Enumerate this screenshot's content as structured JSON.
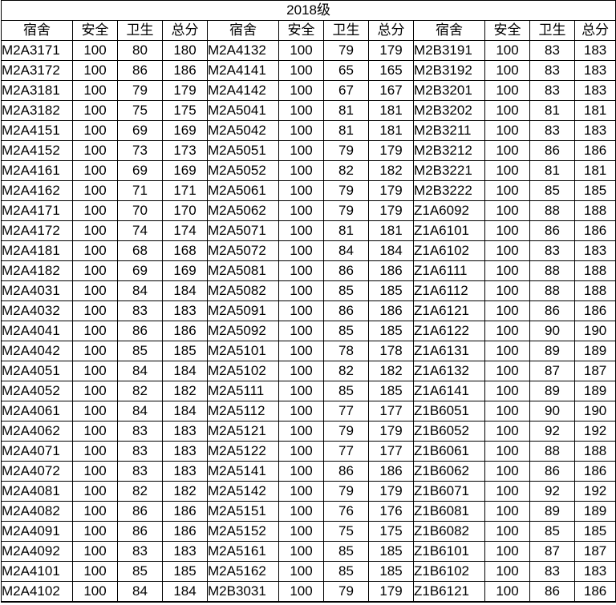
{
  "sheet": {
    "title": "2018级",
    "headers": [
      "宿舍",
      "安全",
      "卫生",
      "总分"
    ],
    "groups": [
      {
        "rows": [
          [
            "M2A3171",
            "100",
            "80",
            "180"
          ],
          [
            "M2A3172",
            "100",
            "86",
            "186"
          ],
          [
            "M2A3181",
            "100",
            "79",
            "179"
          ],
          [
            "M2A3182",
            "100",
            "75",
            "175"
          ],
          [
            "M2A4151",
            "100",
            "69",
            "169"
          ],
          [
            "M2A4152",
            "100",
            "73",
            "173"
          ],
          [
            "M2A4161",
            "100",
            "69",
            "169"
          ],
          [
            "M2A4162",
            "100",
            "71",
            "171"
          ],
          [
            "M2A4171",
            "100",
            "70",
            "170"
          ],
          [
            "M2A4172",
            "100",
            "74",
            "174"
          ],
          [
            "M2A4181",
            "100",
            "68",
            "168"
          ],
          [
            "M2A4182",
            "100",
            "69",
            "169"
          ],
          [
            "M2A4031",
            "100",
            "84",
            "184"
          ],
          [
            "M2A4032",
            "100",
            "83",
            "183"
          ],
          [
            "M2A4041",
            "100",
            "86",
            "186"
          ],
          [
            "M2A4042",
            "100",
            "85",
            "185"
          ],
          [
            "M2A4051",
            "100",
            "84",
            "184"
          ],
          [
            "M2A4052",
            "100",
            "82",
            "182"
          ],
          [
            "M2A4061",
            "100",
            "84",
            "184"
          ],
          [
            "M2A4062",
            "100",
            "83",
            "183"
          ],
          [
            "M2A4071",
            "100",
            "83",
            "183"
          ],
          [
            "M2A4072",
            "100",
            "83",
            "183"
          ],
          [
            "M2A4081",
            "100",
            "82",
            "182"
          ],
          [
            "M2A4082",
            "100",
            "86",
            "186"
          ],
          [
            "M2A4091",
            "100",
            "86",
            "186"
          ],
          [
            "M2A4092",
            "100",
            "83",
            "183"
          ],
          [
            "M2A4101",
            "100",
            "85",
            "185"
          ],
          [
            "M2A4102",
            "100",
            "84",
            "184"
          ]
        ]
      },
      {
        "rows": [
          [
            "M2A4132",
            "100",
            "79",
            "179"
          ],
          [
            "M2A4141",
            "100",
            "65",
            "165"
          ],
          [
            "M2A4142",
            "100",
            "67",
            "167"
          ],
          [
            "M2A5041",
            "100",
            "81",
            "181"
          ],
          [
            "M2A5042",
            "100",
            "81",
            "181"
          ],
          [
            "M2A5051",
            "100",
            "79",
            "179"
          ],
          [
            "M2A5052",
            "100",
            "82",
            "182"
          ],
          [
            "M2A5061",
            "100",
            "79",
            "179"
          ],
          [
            "M2A5062",
            "100",
            "79",
            "179"
          ],
          [
            "M2A5071",
            "100",
            "81",
            "181"
          ],
          [
            "M2A5072",
            "100",
            "84",
            "184"
          ],
          [
            "M2A5081",
            "100",
            "86",
            "186"
          ],
          [
            "M2A5082",
            "100",
            "85",
            "185"
          ],
          [
            "M2A5091",
            "100",
            "86",
            "186"
          ],
          [
            "M2A5092",
            "100",
            "85",
            "185"
          ],
          [
            "M2A5101",
            "100",
            "78",
            "178"
          ],
          [
            "M2A5102",
            "100",
            "82",
            "182"
          ],
          [
            "M2A5111",
            "100",
            "85",
            "185"
          ],
          [
            "M2A5112",
            "100",
            "77",
            "177"
          ],
          [
            "M2A5121",
            "100",
            "79",
            "179"
          ],
          [
            "M2A5122",
            "100",
            "77",
            "177"
          ],
          [
            "M2A5141",
            "100",
            "86",
            "186"
          ],
          [
            "M2A5142",
            "100",
            "79",
            "179"
          ],
          [
            "M2A5151",
            "100",
            "76",
            "176"
          ],
          [
            "M2A5152",
            "100",
            "75",
            "175"
          ],
          [
            "M2A5161",
            "100",
            "85",
            "185"
          ],
          [
            "M2A5162",
            "100",
            "85",
            "185"
          ],
          [
            "M2B3031",
            "100",
            "79",
            "179"
          ]
        ]
      },
      {
        "rows": [
          [
            "M2B3191",
            "100",
            "83",
            "183"
          ],
          [
            "M2B3192",
            "100",
            "83",
            "183"
          ],
          [
            "M2B3201",
            "100",
            "83",
            "183"
          ],
          [
            "M2B3202",
            "100",
            "81",
            "181"
          ],
          [
            "M2B3211",
            "100",
            "83",
            "183"
          ],
          [
            "M2B3212",
            "100",
            "86",
            "186"
          ],
          [
            "M2B3221",
            "100",
            "81",
            "181"
          ],
          [
            "M2B3222",
            "100",
            "85",
            "185"
          ],
          [
            "Z1A6092",
            "100",
            "88",
            "188"
          ],
          [
            "Z1A6101",
            "100",
            "86",
            "186"
          ],
          [
            "Z1A6102",
            "100",
            "83",
            "183"
          ],
          [
            "Z1A6111",
            "100",
            "88",
            "188"
          ],
          [
            "Z1A6112",
            "100",
            "88",
            "188"
          ],
          [
            "Z1A6121",
            "100",
            "86",
            "186"
          ],
          [
            "Z1A6122",
            "100",
            "90",
            "190"
          ],
          [
            "Z1A6131",
            "100",
            "89",
            "189"
          ],
          [
            "Z1A6132",
            "100",
            "87",
            "187"
          ],
          [
            "Z1A6141",
            "100",
            "89",
            "189"
          ],
          [
            "Z1B6051",
            "100",
            "90",
            "190"
          ],
          [
            "Z1B6052",
            "100",
            "92",
            "192"
          ],
          [
            "Z1B6061",
            "100",
            "88",
            "188"
          ],
          [
            "Z1B6062",
            "100",
            "86",
            "186"
          ],
          [
            "Z1B6071",
            "100",
            "92",
            "192"
          ],
          [
            "Z1B6081",
            "100",
            "89",
            "189"
          ],
          [
            "Z1B6082",
            "100",
            "85",
            "185"
          ],
          [
            "Z1B6101",
            "100",
            "87",
            "187"
          ],
          [
            "Z1B6102",
            "100",
            "83",
            "183"
          ],
          [
            "Z1B6121",
            "100",
            "86",
            "186"
          ]
        ]
      }
    ]
  }
}
